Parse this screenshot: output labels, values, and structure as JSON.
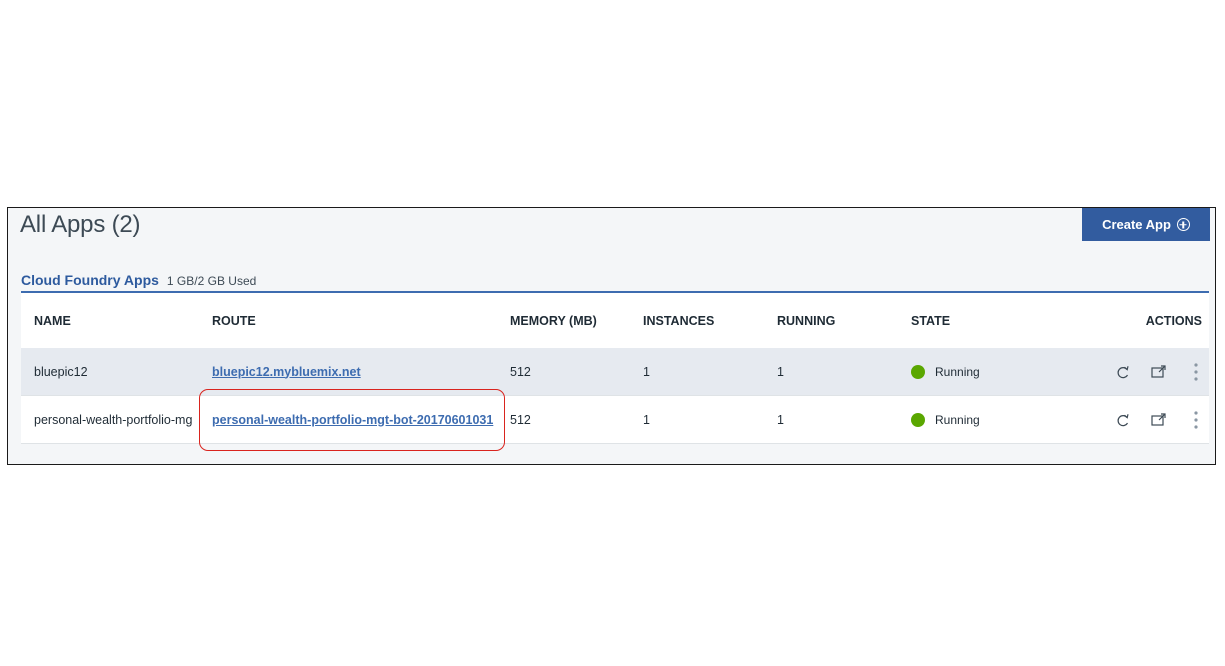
{
  "header": {
    "title": "All Apps (2)",
    "create_button_label": "Create App"
  },
  "section": {
    "title": "Cloud Foundry Apps",
    "usage": "1 GB/2 GB Used"
  },
  "table": {
    "columns": [
      "NAME",
      "ROUTE",
      "MEMORY (MB)",
      "INSTANCES",
      "RUNNING",
      "STATE",
      "ACTIONS"
    ],
    "rows": [
      {
        "name": "bluepic12",
        "route": "bluepic12.mybluemix.net",
        "memory": "512",
        "instances": "1",
        "running": "1",
        "state": "Running"
      },
      {
        "name": "personal-wealth-portfolio-mg",
        "route": "personal-wealth-portfolio-mgt-bot-20170601031",
        "memory": "512",
        "instances": "1",
        "running": "1",
        "state": "Running"
      }
    ]
  },
  "icons": {
    "create": "plus-circle-icon",
    "restart": "restart-icon",
    "open": "open-external-icon",
    "more": "overflow-menu-icon",
    "status": "status-dot-icon"
  },
  "colors": {
    "accent": "#325c9f",
    "link": "#3d6cb0",
    "status_running": "#5aa700",
    "highlight": "#d9241e"
  }
}
